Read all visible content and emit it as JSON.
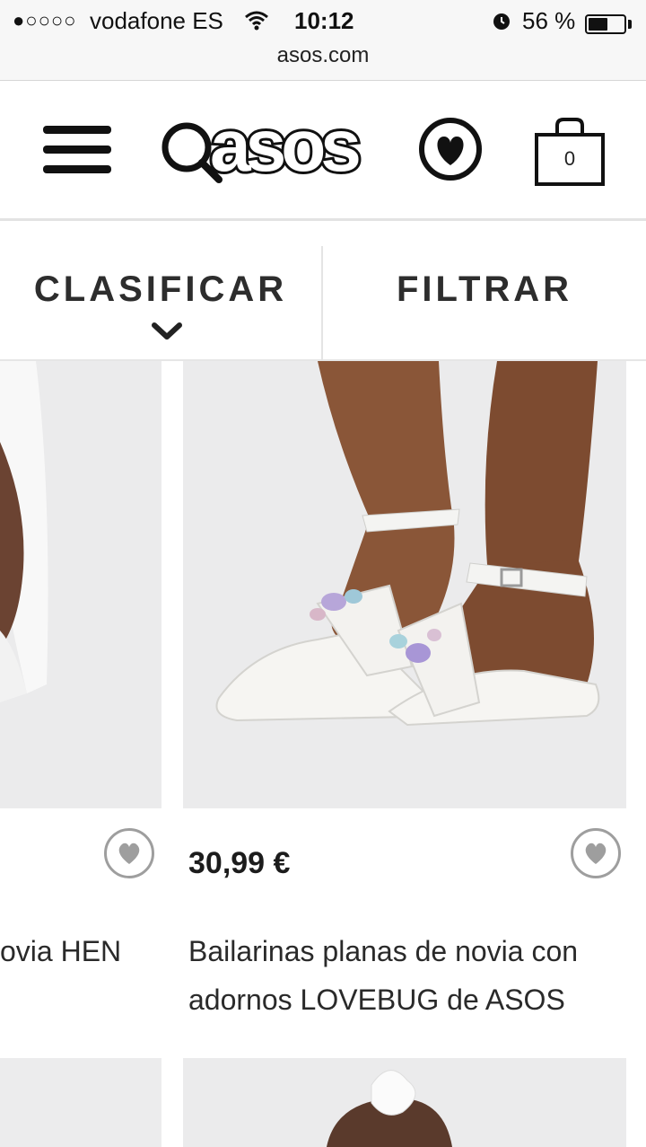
{
  "status_bar": {
    "signal": "●○○○○",
    "carrier": "vodafone ES",
    "time": "10:12",
    "battery_percent": "56 %",
    "battery_level": 0.56,
    "icons": [
      "wifi-icon",
      "alarm-icon",
      "battery-icon"
    ]
  },
  "browser": {
    "url": "asos.com"
  },
  "header": {
    "brand": "asos",
    "bag_count": "0",
    "icons": [
      "hamburger-menu-icon",
      "search-icon",
      "heart-icon",
      "shopping-bag-icon"
    ]
  },
  "toolbar": {
    "sort_label": "CLASIFICAR",
    "filter_label": "FILTRAR",
    "icons": [
      "chevron-down-icon"
    ]
  },
  "products": [
    {
      "price": "",
      "title_visible": "ovia HEN",
      "image": "bride-with-veil-photo"
    },
    {
      "price": "30,99 €",
      "title": "Bailarinas planas de novia con adornos LOVEBUG de ASOS",
      "title_line1": "Bailarinas planas de novia con",
      "title_line2": "adornos LOVEBUG de ASOS",
      "image": "white-satin-flat-shoes-photo"
    }
  ],
  "colors": {
    "text": "#222222",
    "background": "#ffffff",
    "image_bg": "#ececed",
    "heart_border": "#9e9e9e"
  }
}
